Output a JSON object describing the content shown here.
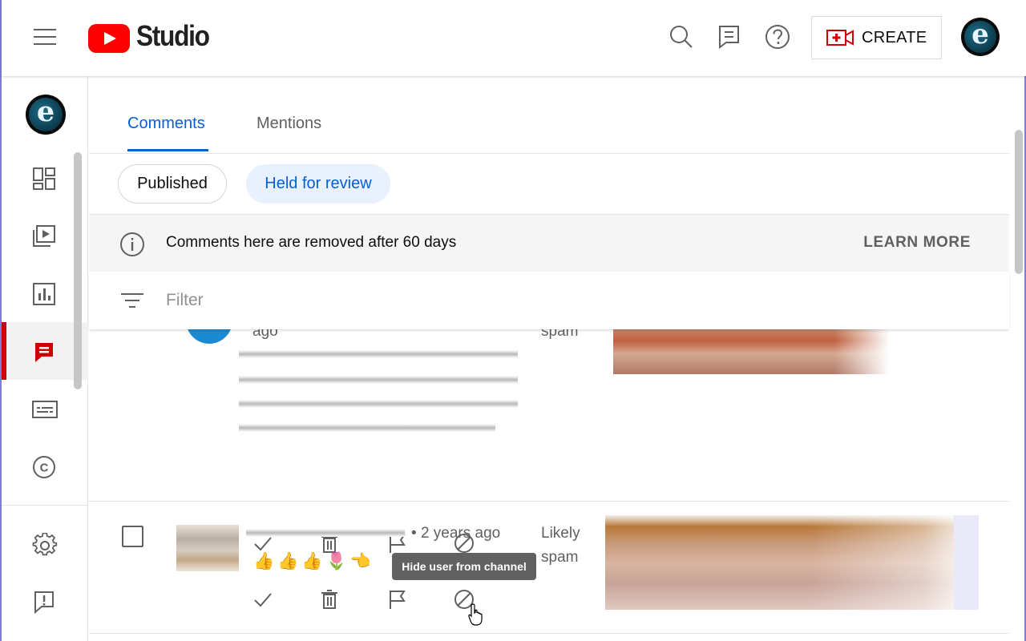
{
  "header": {
    "logo_text": "Studio",
    "create_label": "CREATE",
    "avatar_letter": "e"
  },
  "tabs": [
    {
      "label": "Comments",
      "active": true
    },
    {
      "label": "Mentions",
      "active": false
    }
  ],
  "chips": {
    "published": "Published",
    "held": "Held for review"
  },
  "info": {
    "text": "Comments here are removed after 60 days",
    "learn_more": "LEARN MORE"
  },
  "filter": {
    "placeholder": "Filter"
  },
  "comments": [
    {
      "time": "ago",
      "status": "spam"
    },
    {
      "time": "2 years ago",
      "status_line1": "Likely",
      "status_line2": "spam",
      "emojis": "👍👍👍🌷👈"
    }
  ],
  "tooltip": "Hide user from channel",
  "colors": {
    "accent_blue": "#065fd4",
    "brand_red": "#ff0000",
    "active_red": "#cc0000"
  },
  "sidebar_icons": [
    "dashboard-icon",
    "content-icon",
    "analytics-icon",
    "comments-icon",
    "subtitles-icon",
    "copyright-icon",
    "settings-icon",
    "feedback-icon"
  ]
}
